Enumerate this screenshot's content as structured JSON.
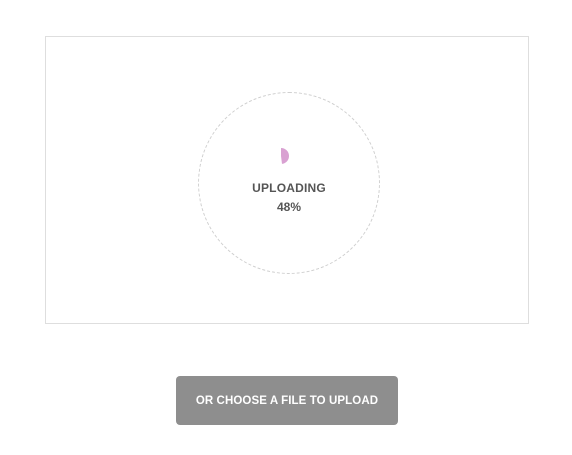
{
  "upload": {
    "status_label": "UPLOADING",
    "progress_text": "48%",
    "progress_fraction": 0.48,
    "accent_color": "#d9a1d2"
  },
  "choose_button": {
    "label": "OR CHOOSE A FILE TO UPLOAD",
    "color": "#8e8e8e"
  },
  "icons": {
    "progress_icon": "pie-progress-icon"
  }
}
